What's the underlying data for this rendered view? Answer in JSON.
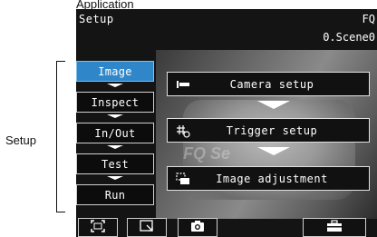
{
  "annotation": {
    "top_caption": "Application",
    "side_label": "Setup"
  },
  "header": {
    "title": "Setup",
    "device": "FQ",
    "scene": "0.Scene0"
  },
  "background": {
    "ghost_text": "FQ Se"
  },
  "menu": {
    "items": [
      {
        "label": "Image",
        "active": true
      },
      {
        "label": "Inspect",
        "active": false
      },
      {
        "label": "In/Out",
        "active": false
      },
      {
        "label": "Test",
        "active": false
      },
      {
        "label": "Run",
        "active": false
      }
    ]
  },
  "submenu": {
    "items": [
      {
        "label": "Camera setup",
        "icon": "camera-setup-icon"
      },
      {
        "label": "Trigger setup",
        "icon": "trigger-setup-icon"
      },
      {
        "label": "Image adjustment",
        "icon": "image-adjustment-icon"
      }
    ]
  },
  "toolbar": {
    "icons": [
      "frame-icon",
      "zoom-icon",
      "camera-icon",
      "toolbox-icon"
    ]
  },
  "colors": {
    "active_menu": "#2f86c9",
    "screen_bg": "#141414"
  }
}
